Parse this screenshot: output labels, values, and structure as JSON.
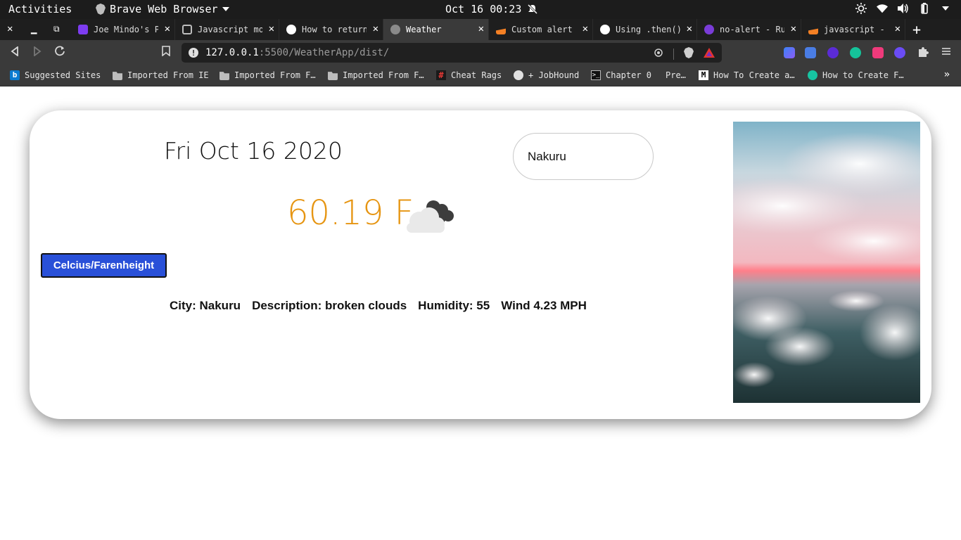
{
  "topbar": {
    "activities": "Activities",
    "app_name": "Brave Web Browser",
    "clock": "Oct 16 00:23"
  },
  "tabs": [
    {
      "title": "Joe Mindo's P",
      "color": "#7d3cf0",
      "active": false
    },
    {
      "title": "Javascript mo",
      "color": "#bdbdbd",
      "active": false
    },
    {
      "title": "How to return",
      "color": "#ffffff",
      "active": false
    },
    {
      "title": "Weather",
      "color": "#8a8a8a",
      "active": true
    },
    {
      "title": "Custom alert",
      "color": "#f48024",
      "active": false
    },
    {
      "title": "Using .then()",
      "color": "#ffffff",
      "active": false
    },
    {
      "title": "no-alert - Ru",
      "color": "#7a3cd8",
      "active": false
    },
    {
      "title": "javascript -",
      "color": "#f48024",
      "active": false
    }
  ],
  "address": {
    "host": "127.0.0.1",
    "path": ":5500/WeatherApp/dist/"
  },
  "bookmarks": [
    {
      "label": "Suggested Sites",
      "kind": "bing"
    },
    {
      "label": "Imported From IE",
      "kind": "folder"
    },
    {
      "label": "Imported From F…",
      "kind": "folder"
    },
    {
      "label": "Imported From F…",
      "kind": "folder"
    },
    {
      "label": "Cheat Rags",
      "kind": "hash"
    },
    {
      "label": "+ JobHound",
      "kind": "globe"
    },
    {
      "label": "Chapter 0",
      "kind": "terminal"
    },
    {
      "label": "Pre…",
      "kind": "none"
    },
    {
      "label": "How To Create a…",
      "kind": "medium"
    },
    {
      "label": "How to Create F…",
      "kind": "teal"
    }
  ],
  "weather": {
    "date": "Fri Oct 16 2020",
    "city_input_value": "Nakuru",
    "temperature": "60.19 F",
    "icon": "broken-clouds-icon",
    "unit_button": "Celcius/Farenheight",
    "details": {
      "city": "City: Nakuru",
      "description": "Description: broken clouds",
      "humidity": "Humidity: 55",
      "wind": "Wind 4.23 MPH"
    },
    "temp_color": "#e69512",
    "button_color": "#2950d8"
  }
}
